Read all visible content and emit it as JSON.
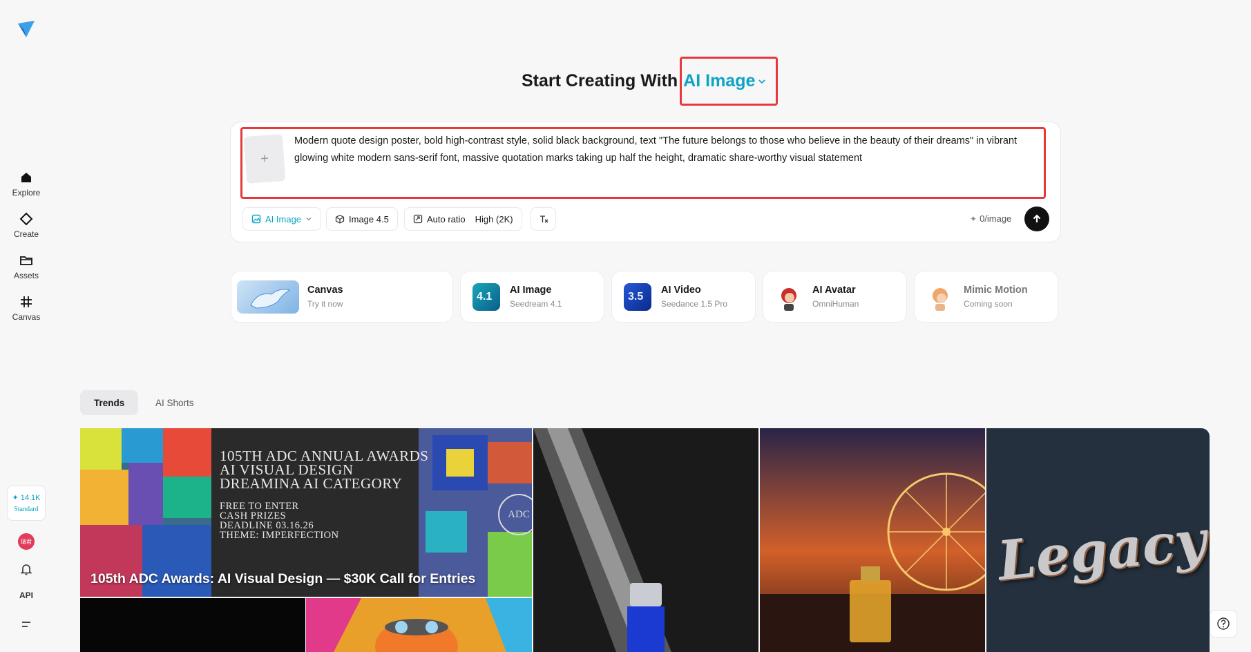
{
  "sidebar": {
    "items": [
      {
        "label": "Explore",
        "icon": "home-icon"
      },
      {
        "label": "Create",
        "icon": "diamond-icon"
      },
      {
        "label": "Assets",
        "icon": "folder-icon"
      },
      {
        "label": "Canvas",
        "icon": "grid-icon"
      }
    ],
    "credits_amount": "14.1K",
    "credits_tier": "Standard",
    "avatar_text": "瑞君",
    "api_label": "API"
  },
  "heading": {
    "prefix": "Start Creating With",
    "mode": "AI Image"
  },
  "prompt": {
    "text": "Modern quote design poster, bold high-contrast style, solid black background, text \"The future belongs to those who believe in the beauty of their dreams\" in vibrant glowing white modern sans-serif font, massive quotation marks taking up half the height, dramatic share-worthy visual statement",
    "add_symbol": "+"
  },
  "toolbar": {
    "mode_label": "AI Image",
    "model_label": "Image 4.5",
    "ratio_label": "Auto ratio",
    "quality_label": "High (2K)",
    "cost_label": "0/image"
  },
  "features": [
    {
      "title": "Canvas",
      "subtitle": "Try it now"
    },
    {
      "title": "AI Image",
      "subtitle": "Seedream 4.1",
      "badge": "4.1"
    },
    {
      "title": "AI Video",
      "subtitle": "Seedance 1.5 Pro",
      "badge": "3.5"
    },
    {
      "title": "AI Avatar",
      "subtitle": "OmniHuman"
    },
    {
      "title": "Mimic Motion",
      "subtitle": "Coming soon"
    }
  ],
  "tabs": [
    {
      "label": "Trends",
      "active": true
    },
    {
      "label": "AI Shorts",
      "active": false
    }
  ],
  "gallery": {
    "adc_caption": "105th ADC Awards: AI Visual Design — $30K Call for Entries",
    "adc_poster_lines": [
      "105TH ADC ANNUAL AWARDS",
      "AI VISUAL DESIGN",
      "DREAMINA AI CATEGORY"
    ],
    "adc_poster_small": [
      "FREE TO ENTER",
      "CASH PRIZES",
      "DEADLINE 03.16.26",
      "THEME: IMPERFECTION"
    ],
    "adc_seal": "ADC",
    "legacy_text": "Legacy"
  },
  "colors": {
    "accent": "#0ba4c4",
    "highlight_box": "#e6393b"
  }
}
